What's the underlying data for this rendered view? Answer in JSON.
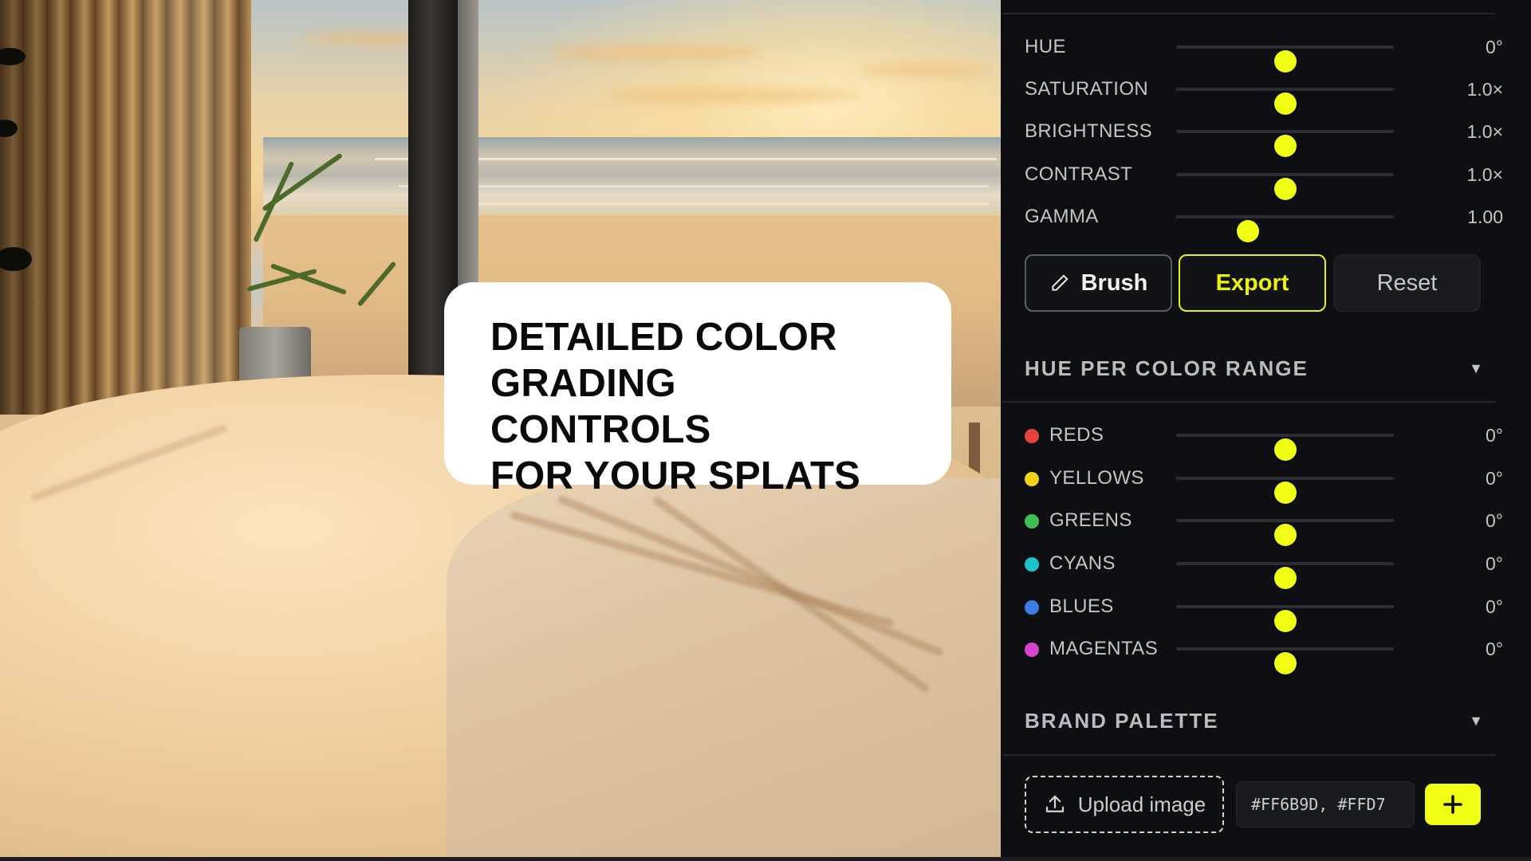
{
  "caption": {
    "lines": [
      "DETAILED COLOR",
      "GRADING CONTROLS",
      "FOR YOUR SPLATS"
    ]
  },
  "adjustments": [
    {
      "label": "HUE",
      "value": "0°",
      "level": 0.5
    },
    {
      "label": "SATURATION",
      "value": "1.0×",
      "level": 0.5
    },
    {
      "label": "BRIGHTNESS",
      "value": "1.0×",
      "level": 0.5
    },
    {
      "label": "CONTRAST",
      "value": "1.0×",
      "level": 0.5
    },
    {
      "label": "GAMMA",
      "value": "1.00",
      "level": 0.33
    }
  ],
  "actions": {
    "brush": "Brush",
    "export": "Export",
    "reset": "Reset"
  },
  "hue_per_color_range": {
    "title": "HUE PER COLOR RANGE",
    "chevron": "▼",
    "items": [
      {
        "label": "REDS",
        "value": "0°",
        "color": "#e8423c",
        "level": 0.5
      },
      {
        "label": "YELLOWS",
        "value": "0°",
        "color": "#f3d21a",
        "level": 0.5
      },
      {
        "label": "GREENS",
        "value": "0°",
        "color": "#3fbf4f",
        "level": 0.5
      },
      {
        "label": "CYANS",
        "value": "0°",
        "color": "#1cc3c9",
        "level": 0.5
      },
      {
        "label": "BLUES",
        "value": "0°",
        "color": "#3b7fe6",
        "level": 0.5
      },
      {
        "label": "MAGENTAS",
        "value": "0°",
        "color": "#d444cf",
        "level": 0.5
      }
    ]
  },
  "brand_palette": {
    "title": "BRAND PALETTE",
    "chevron": "▼",
    "upload_label": "Upload image",
    "hex_value": "#FF6B9D, #FFD7"
  },
  "colors": {
    "accent": "#f0ff14",
    "panel_bg": "#0e0f12"
  }
}
